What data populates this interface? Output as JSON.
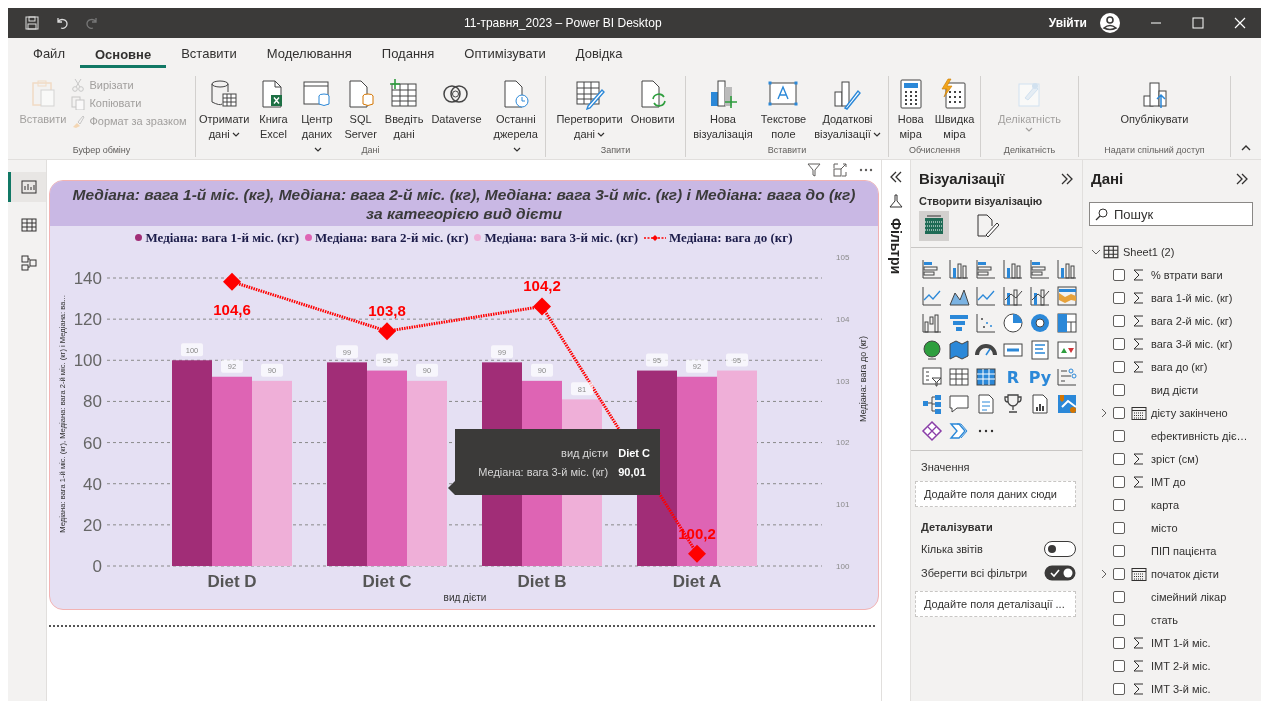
{
  "window": {
    "title": "11-травня_2023 – Power BI Desktop",
    "sign_in": "Увійти"
  },
  "tabs": [
    {
      "label": "Файл",
      "selected": false
    },
    {
      "label": "Основне",
      "selected": true
    },
    {
      "label": "Вставити",
      "selected": false
    },
    {
      "label": "Моделювання",
      "selected": false
    },
    {
      "label": "Подання",
      "selected": false
    },
    {
      "label": "Оптимізувати",
      "selected": false
    },
    {
      "label": "Довідка",
      "selected": false
    }
  ],
  "ribbon": {
    "groups": [
      {
        "label": "Буфер обміну",
        "items": [
          {
            "kind": "large",
            "label": "Вставити",
            "disabled": true,
            "dropdown": false
          },
          {
            "kind": "small",
            "label": "Вирізати",
            "disabled": true
          },
          {
            "kind": "small",
            "label": "Копіювати",
            "disabled": true
          },
          {
            "kind": "small",
            "label": "Формат за зразком",
            "disabled": true
          }
        ]
      },
      {
        "label": "Дані",
        "items": [
          {
            "kind": "large",
            "label": "Отримати\nдані",
            "disabled": false,
            "dropdown": true
          },
          {
            "kind": "large",
            "label": "Книга\nExcel",
            "disabled": false,
            "dropdown": false
          },
          {
            "kind": "large",
            "label": "Центр\nданих",
            "disabled": false,
            "dropdown": true
          },
          {
            "kind": "large",
            "label": "SQL\nServer",
            "disabled": false,
            "dropdown": false
          },
          {
            "kind": "large",
            "label": "Введіть\nдані",
            "disabled": false,
            "dropdown": false
          },
          {
            "kind": "large",
            "label": "Dataverse",
            "disabled": false,
            "dropdown": false
          },
          {
            "kind": "large",
            "label": "Останні\nджерела",
            "disabled": false,
            "dropdown": true
          }
        ]
      },
      {
        "label": "Запити",
        "items": [
          {
            "kind": "large",
            "label": "Перетворити\nдані",
            "disabled": false,
            "dropdown": true
          },
          {
            "kind": "large",
            "label": "Оновити",
            "disabled": false,
            "dropdown": false
          }
        ]
      },
      {
        "label": "Вставити",
        "items": [
          {
            "kind": "large",
            "label": "Нова\nвізуалізація",
            "disabled": false,
            "dropdown": false
          },
          {
            "kind": "large",
            "label": "Текстове\nполе",
            "disabled": false,
            "dropdown": false
          },
          {
            "kind": "large",
            "label": "Додаткові\nвізуалізації",
            "disabled": false,
            "dropdown": true
          }
        ]
      },
      {
        "label": "Обчислення",
        "items": [
          {
            "kind": "large",
            "label": "Нова\nміра",
            "disabled": false,
            "dropdown": false
          },
          {
            "kind": "large",
            "label": "Швидка\nміра",
            "disabled": false,
            "dropdown": false
          }
        ]
      },
      {
        "label": "Делікатність",
        "items": [
          {
            "kind": "large",
            "label": "Делікатність",
            "disabled": true,
            "dropdown": true
          }
        ]
      },
      {
        "label": "Надати спільний доступ",
        "items": [
          {
            "kind": "large",
            "label": "Опублікувати",
            "disabled": false,
            "dropdown": false
          }
        ]
      }
    ]
  },
  "nav": [
    {
      "selected": true
    },
    {
      "selected": false
    },
    {
      "selected": false
    }
  ],
  "chart": {
    "chart_data": {
      "type": "bar",
      "title": "Медіана: вага 1-й міс. (кг), Медіана: вага 2-й міс. (кг), Медіана: вага 3-й міс. (кг) і Медіана: вага до (кг) за категорією вид дієти",
      "xlabel": "вид дієти",
      "ylabel": "Медіана: вага 1-й міс. (кг), Медіана: вага 2-й міс. (кг) і Медіана: ва...",
      "y2label": "Медіана: вага до (кг)",
      "categories": [
        "Diet D",
        "Diet C",
        "Diet B",
        "Diet A"
      ],
      "series": [
        {
          "name": "Медіана: вага 1-й міс. (кг)",
          "type": "bar",
          "color": "#a12d77",
          "values": [
            100,
            99,
            99,
            95
          ],
          "value_labels": [
            "100",
            "99",
            "99",
            "95"
          ]
        },
        {
          "name": "Медіана: вага 2-й міс. (кг)",
          "type": "bar",
          "color": "#de64b4",
          "values": [
            92,
            95,
            90,
            92
          ],
          "value_labels": [
            "92",
            "95",
            "90",
            "92"
          ]
        },
        {
          "name": "Медіана: вага 3-й міс. (кг)",
          "type": "bar",
          "color": "#efafd8",
          "values": [
            90,
            90,
            81,
            95
          ],
          "value_labels": [
            "90",
            "90",
            "81",
            "95"
          ]
        },
        {
          "name": "Медіана: вага до (кг)",
          "type": "line",
          "axis": "y2",
          "line_style": "dotted",
          "marker": "diamond",
          "color": "#ff0000",
          "values": [
            104.6,
            103.8,
            104.2,
            100.2
          ],
          "value_labels": [
            "104,6",
            "103,8",
            "104,2",
            "100,2"
          ]
        }
      ],
      "ylim": [
        0,
        140
      ],
      "yticks": [
        0,
        20,
        40,
        60,
        80,
        100,
        120,
        140
      ],
      "y2lim": [
        100,
        105
      ],
      "y2ticks": [
        100,
        101,
        102,
        103,
        104,
        105
      ],
      "grid": true,
      "legend": "top"
    },
    "tooltip": {
      "rows": [
        {
          "label": "вид дієти",
          "value": "Diet C"
        },
        {
          "label": "Медіана: вага 3-й міс. (кг)",
          "value": "90,01"
        }
      ]
    }
  },
  "filters_pane": {
    "label": "Фільтри"
  },
  "visualizations": {
    "title": "Візуалізації",
    "subtitle": "Створити візуалізацію",
    "modes": [
      {
        "selected": true
      },
      {
        "selected": false
      }
    ],
    "gallery_text": [
      "R",
      "Py"
    ],
    "wells": [
      {
        "label": "Значення",
        "placeholder": "Додайте поля даних сюди"
      }
    ],
    "drillthrough": {
      "label": "Деталізувати",
      "toggles": [
        {
          "label": "Кілька звітів",
          "on": false
        },
        {
          "label": "Зберегти всі фільтри",
          "on": true
        }
      ],
      "placeholder": "Додайте поля деталізації ..."
    }
  },
  "data_pane": {
    "title": "Дані",
    "search": {
      "placeholder": "Пошук"
    },
    "tree": [
      {
        "label": "Sheet1 (2)",
        "expanded": true,
        "children": [
          {
            "label": "% втрати ваги",
            "kind": "measure",
            "checked": false
          },
          {
            "label": "вага 1-й міс. (кг)",
            "kind": "measure",
            "checked": false
          },
          {
            "label": "вага 2-й міс. (кг)",
            "kind": "measure",
            "checked": false
          },
          {
            "label": "вага 3-й міс. (кг)",
            "kind": "measure",
            "checked": false
          },
          {
            "label": "вага до (кг)",
            "kind": "measure",
            "checked": false
          },
          {
            "label": "вид дієти",
            "kind": "text",
            "checked": false
          },
          {
            "label": "дієту закінчено",
            "kind": "date",
            "checked": false,
            "expanded": false
          },
          {
            "label": "ефективність діє…",
            "kind": "text",
            "checked": false
          },
          {
            "label": "зріст (см)",
            "kind": "measure",
            "checked": false
          },
          {
            "label": "ІМТ до",
            "kind": "measure",
            "checked": false
          },
          {
            "label": "карта",
            "kind": "text",
            "checked": false
          },
          {
            "label": "місто",
            "kind": "text",
            "checked": false
          },
          {
            "label": "ПІП пацієнта",
            "kind": "text",
            "checked": false
          },
          {
            "label": "початок дієти",
            "kind": "date",
            "checked": false,
            "expanded": false
          },
          {
            "label": "сімейний лікар",
            "kind": "text",
            "checked": false
          },
          {
            "label": "стать",
            "kind": "text",
            "checked": false
          },
          {
            "label": "ІМТ 1-й міс.",
            "kind": "measure",
            "checked": false
          },
          {
            "label": "ІМТ 2-й міс.",
            "kind": "measure",
            "checked": false
          },
          {
            "label": "ІМТ 3-й міс.",
            "kind": "measure",
            "checked": false
          }
        ]
      }
    ]
  }
}
